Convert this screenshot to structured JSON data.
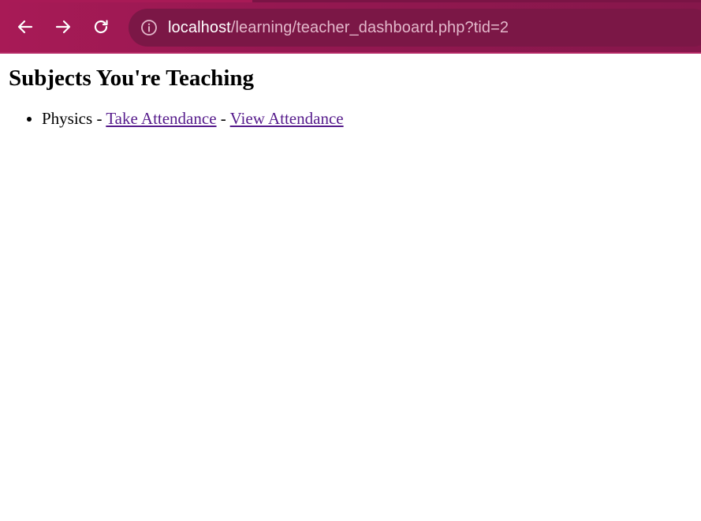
{
  "browser": {
    "url_host": "localhost",
    "url_path": "/learning/teacher_dashboard.php?tid=2",
    "icons": {
      "back": "back-arrow-icon",
      "forward": "forward-arrow-icon",
      "reload": "reload-icon",
      "site_info": "info-circle-icon"
    },
    "colors": {
      "toolbar": "#951851",
      "omnibox": "#7b1746",
      "url_path_text": "#e3b8cb"
    }
  },
  "page": {
    "title": "Subjects You're Teaching",
    "subjects": [
      {
        "name": "Physics",
        "separator1": " - ",
        "take_attendance_label": "Take Attendance",
        "separator2": " - ",
        "view_attendance_label": "View Attendance"
      }
    ],
    "link_color": "#551a8b"
  }
}
